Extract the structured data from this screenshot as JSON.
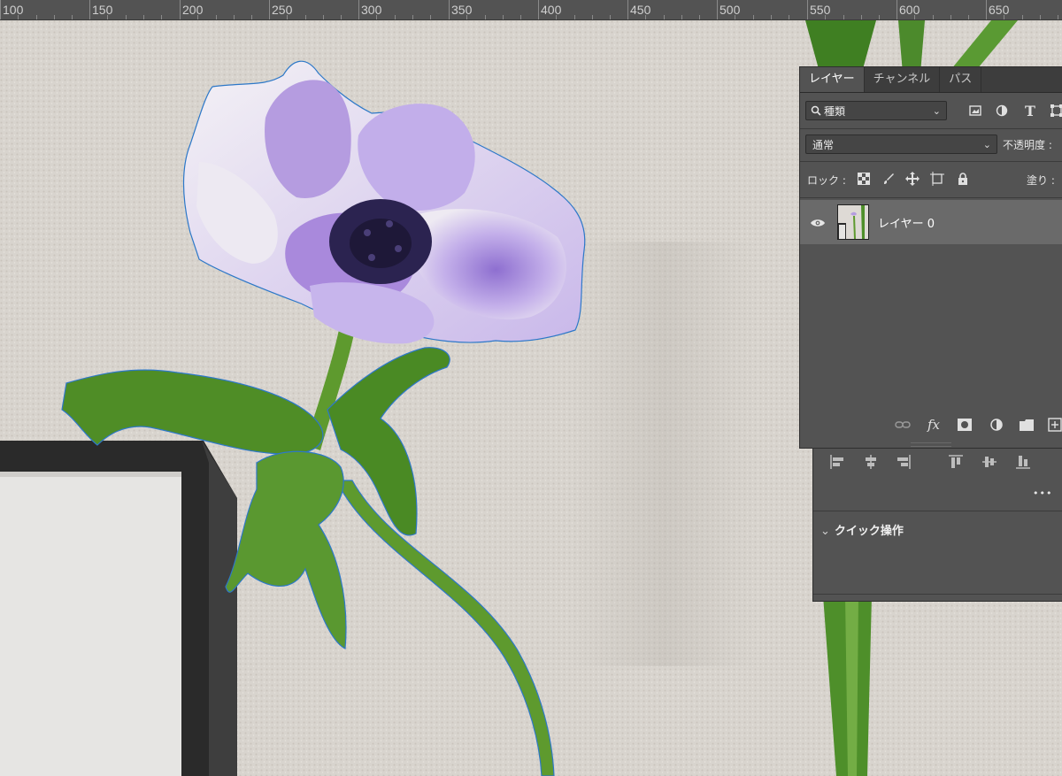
{
  "ruler": {
    "labels": [
      "100",
      "150",
      "200",
      "250",
      "300",
      "350",
      "400",
      "450",
      "500",
      "550",
      "600",
      "650"
    ]
  },
  "layers_panel": {
    "tabs": [
      {
        "label": "レイヤー",
        "active": true
      },
      {
        "label": "チャンネル",
        "active": false
      },
      {
        "label": "パス",
        "active": false
      }
    ],
    "filter_kind": "種類",
    "blend_mode": "通常",
    "opacity_label": "不透明度 :",
    "lock_label": "ロック :",
    "fill_label": "塗り :",
    "layers": [
      {
        "name": "レイヤー 0",
        "visible": true,
        "selected": true
      }
    ],
    "footer_icons": [
      "link-icon",
      "fx-icon",
      "mask-icon",
      "adjustment-icon",
      "folder-icon",
      "new-layer-icon"
    ]
  },
  "props_panel": {
    "more_label": "•••",
    "quick_actions_label": "クイック操作"
  },
  "colors": {
    "panel_bg": "#535353",
    "tab_bar_bg": "#3d3d3d",
    "selected_layer_bg": "#6a6a6a",
    "selection_outline": "#2d78c8",
    "wall": "#d9d5cf",
    "petal": "#b9a2e0",
    "stem": "#5f9a35"
  }
}
